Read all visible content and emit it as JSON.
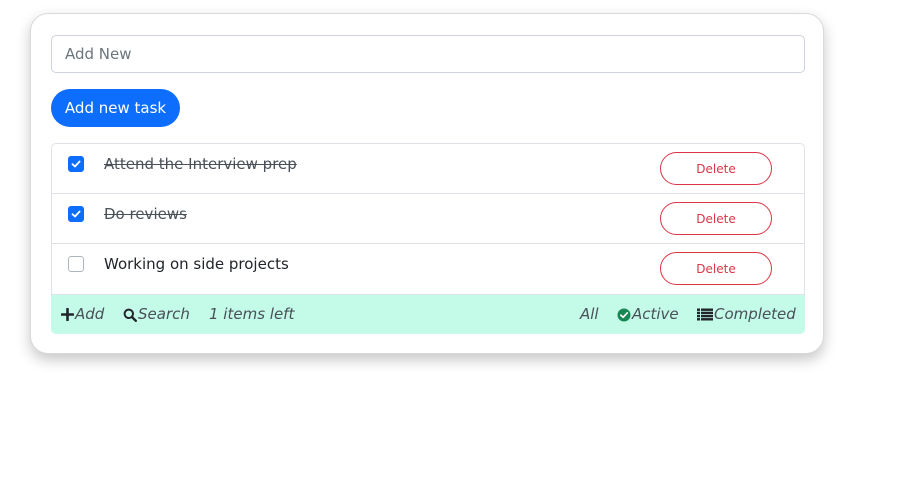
{
  "input": {
    "placeholder": "Add New",
    "value": ""
  },
  "add_button": {
    "label": "Add new task"
  },
  "tasks": [
    {
      "text": "Attend the Interview prep",
      "completed": true,
      "delete_label": "Delete"
    },
    {
      "text": "Do reviews",
      "completed": true,
      "delete_label": "Delete"
    },
    {
      "text": "Working on side projects",
      "completed": false,
      "delete_label": "Delete"
    }
  ],
  "footer": {
    "add_label": "Add",
    "search_label": "Search",
    "items_left": "1 items left",
    "filter_all": "All",
    "filter_active": "Active",
    "filter_completed": "Completed"
  },
  "colors": {
    "primary": "#0d6efd",
    "danger": "#dc3545",
    "footer_bg": "#c3fae8",
    "active_icon": "#198754"
  },
  "icons": {
    "add": "plus-icon",
    "search": "magnifier-icon",
    "active": "check-circle-icon",
    "completed": "list-icon"
  }
}
